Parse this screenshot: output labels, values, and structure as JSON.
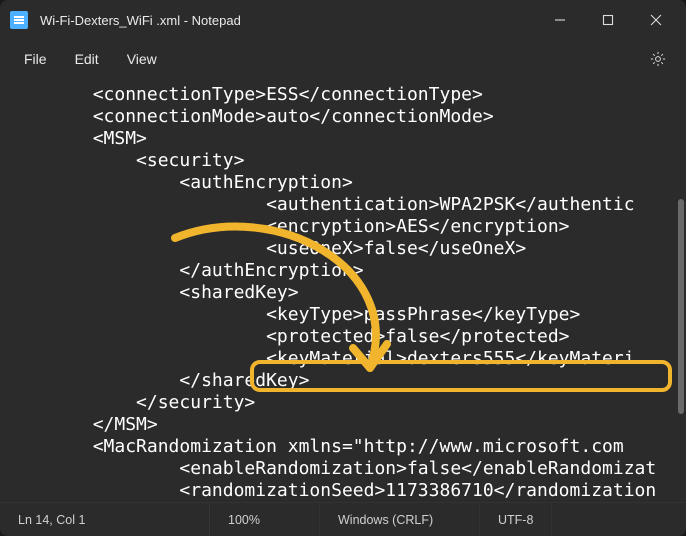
{
  "window": {
    "title": "Wi-Fi-Dexters_WiFi .xml - Notepad"
  },
  "menu": {
    "file": "File",
    "edit": "Edit",
    "view": "View"
  },
  "content": {
    "lines": [
      "        <connectionType>ESS</connectionType>",
      "        <connectionMode>auto</connectionMode>",
      "        <MSM>",
      "            <security>",
      "                <authEncryption>",
      "                        <authentication>WPA2PSK</authentic",
      "                        <encryption>AES</encryption>",
      "                        <useOneX>false</useOneX>",
      "                </authEncryption>",
      "                <sharedKey>",
      "                        <keyType>passPhrase</keyType>",
      "                        <protected>false</protected>",
      "                        <keyMaterial>dexters555</keyMateri",
      "                </sharedKey>",
      "            </security>",
      "        </MSM>",
      "        <MacRandomization xmlns=\"http://www.microsoft.com",
      "                <enableRandomization>false</enableRandomizat",
      "                <randomizationSeed>1173386710</randomization"
    ]
  },
  "status": {
    "cursor": "Ln 14, Col 1",
    "zoom": "100%",
    "line_ending": "Windows (CRLF)",
    "encoding": "UTF-8"
  }
}
